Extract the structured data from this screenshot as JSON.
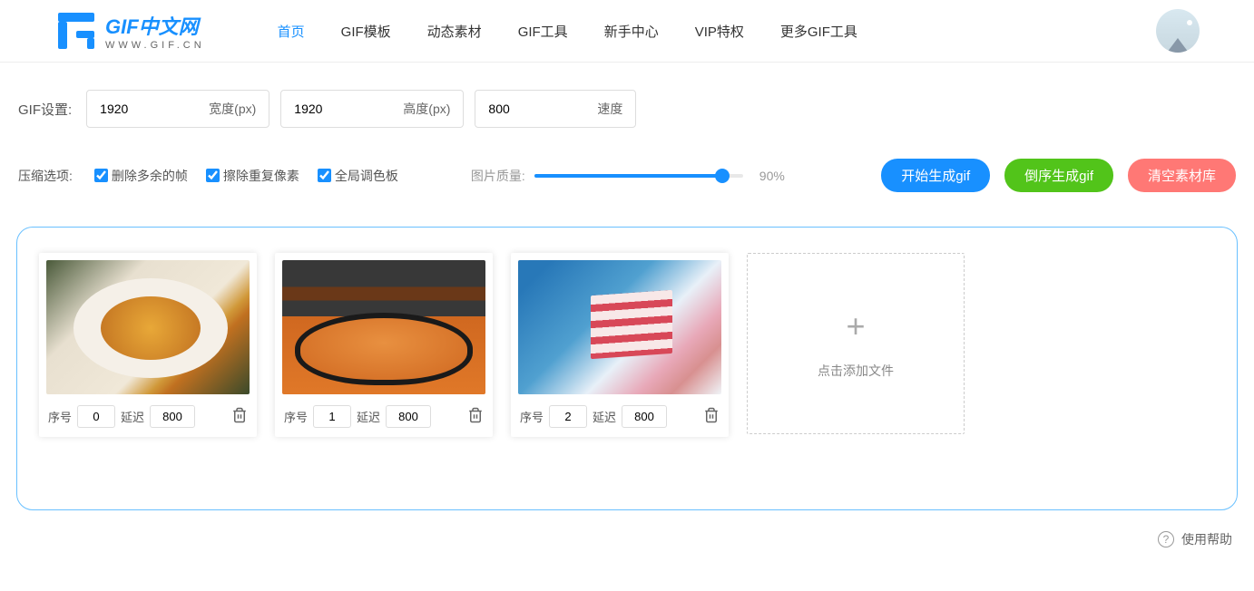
{
  "header": {
    "logo_main": "GIF中文网",
    "logo_sub": "WWW.GIF.CN",
    "nav": [
      {
        "label": "首页",
        "active": true
      },
      {
        "label": "GIF模板",
        "active": false
      },
      {
        "label": "动态素材",
        "active": false
      },
      {
        "label": "GIF工具",
        "active": false
      },
      {
        "label": "新手中心",
        "active": false
      },
      {
        "label": "VIP特权",
        "active": false
      },
      {
        "label": "更多GIF工具",
        "active": false
      }
    ]
  },
  "settings": {
    "label": "GIF设置:",
    "width": {
      "value": "1920",
      "suffix": "宽度(px)"
    },
    "height": {
      "value": "1920",
      "suffix": "高度(px)"
    },
    "speed": {
      "value": "800",
      "suffix": "速度"
    }
  },
  "compress": {
    "label": "压缩选项:",
    "options": [
      {
        "label": "删除多余的帧",
        "checked": true
      },
      {
        "label": "擦除重复像素",
        "checked": true
      },
      {
        "label": "全局调色板",
        "checked": true
      }
    ],
    "quality_label": "图片质量:",
    "quality_value": "90%"
  },
  "actions": {
    "start": "开始生成gif",
    "reverse": "倒序生成gif",
    "clear": "清空素材库"
  },
  "frames": [
    {
      "index_label": "序号",
      "index_value": "0",
      "delay_label": "延迟",
      "delay_value": "800"
    },
    {
      "index_label": "序号",
      "index_value": "1",
      "delay_label": "延迟",
      "delay_value": "800"
    },
    {
      "index_label": "序号",
      "index_value": "2",
      "delay_label": "延迟",
      "delay_value": "800"
    }
  ],
  "add_card": {
    "label": "点击添加文件"
  },
  "footer": {
    "help": "使用帮助"
  }
}
